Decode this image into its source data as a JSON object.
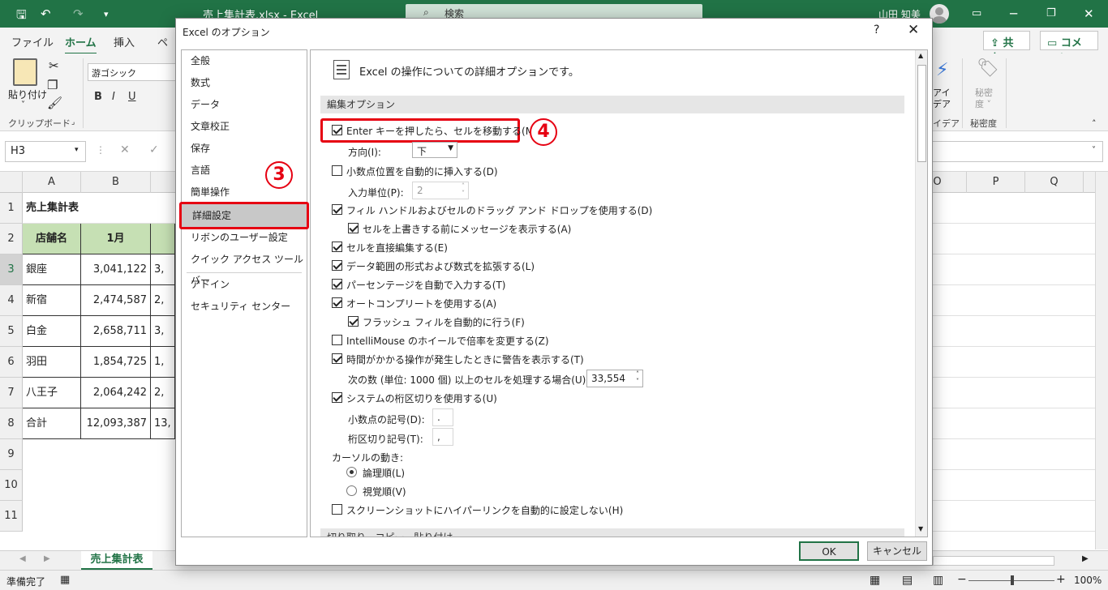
{
  "titlebar": {
    "title": "売上集計表.xlsx  -  Excel",
    "search_label": "検索",
    "user_name": "山田 知美"
  },
  "ribbon": {
    "tabs": [
      "ファイル",
      "ホーム",
      "挿入",
      "ペ"
    ],
    "share_label": "共有",
    "comment_label": "コメント",
    "paste_label": "貼り付け",
    "font_name": "游ゴシック",
    "clipboard_label": "クリップボード",
    "ideas_line1": "アイ",
    "ideas_line2": "デア",
    "ideas_group_label": "イデア",
    "sensitivity_line1": "秘密",
    "sensitivity_line2": "度 ˅",
    "sensitivity_group_label": "秘密度"
  },
  "formulabar": {
    "cell_ref": "H3"
  },
  "grid": {
    "columns_left": [
      "A",
      "B"
    ],
    "columns_right": [
      "O",
      "P",
      "Q"
    ],
    "rows": [
      "1",
      "2",
      "3",
      "4",
      "5",
      "6",
      "7",
      "8",
      "9",
      "10",
      "11"
    ],
    "title": "売上集計表",
    "header_store": "店舗名",
    "header_month": "1月",
    "data": [
      {
        "store": "銀座",
        "jan": "3,041,122",
        "next": "3,"
      },
      {
        "store": "新宿",
        "jan": "2,474,587",
        "next": "2,"
      },
      {
        "store": "白金",
        "jan": "2,658,711",
        "next": "3,"
      },
      {
        "store": "羽田",
        "jan": "1,854,725",
        "next": "1,"
      },
      {
        "store": "八王子",
        "jan": "2,064,242",
        "next": "2,"
      },
      {
        "store": "合計",
        "jan": "12,093,387",
        "next": "13,"
      }
    ]
  },
  "sheet": {
    "tab_name": "売上集計表"
  },
  "status": {
    "ready": "準備完了",
    "zoom": "100%"
  },
  "dialog": {
    "title": "Excel のオプション",
    "help": "?",
    "close": "✕",
    "nav": [
      "全般",
      "数式",
      "データ",
      "文章校正",
      "保存",
      "言語",
      "簡単操作",
      "詳細設定",
      "リボンのユーザー設定",
      "クイック アクセス ツール バー",
      "アドイン",
      "セキュリティ センター"
    ],
    "badge3": "3",
    "badge4": "4",
    "heading": "Excel の操作についての詳細オプションです。",
    "section_edit": "編集オプション",
    "section_cut": "切り取り、コピー、貼り付け",
    "options": {
      "enter_move": "Enter キーを押したら、セルを移動する(M)",
      "direction_label": "方向(I):",
      "direction_value": "下",
      "auto_decimal": "小数点位置を自動的に挿入する(D)",
      "places_label": "入力単位(P):",
      "places_value": "2",
      "fill_handle": "フィル ハンドルおよびセルのドラッグ アンド ドロップを使用する(D)",
      "alert_overwrite": "セルを上書きする前にメッセージを表示する(A)",
      "direct_edit": "セルを直接編集する(E)",
      "extend_range": "データ範囲の形式および数式を拡張する(L)",
      "percent_entry": "パーセンテージを自動で入力する(T)",
      "autocomplete": "オートコンプリートを使用する(A)",
      "flash_fill": "フラッシュ フィルを自動的に行う(F)",
      "intellimouse": "IntelliMouse のホイールで倍率を変更する(Z)",
      "long_op_alert": "時間がかかる操作が発生したときに警告を表示する(T)",
      "cells_label": "次の数 (単位: 1000 個) 以上のセルを処理する場合(U):",
      "cells_value": "33,554",
      "system_sep": "システムの桁区切りを使用する(U)",
      "decimal_sep_label": "小数点の記号(D):",
      "decimal_sep_value": ".",
      "thousands_sep_label": "桁区切り記号(T):",
      "thousands_sep_value": ",",
      "cursor_label": "カーソルの動き:",
      "logical": "論理順(L)",
      "visual": "視覚順(V)",
      "screenshot_link": "スクリーンショットにハイパーリンクを自動的に設定しない(H)"
    },
    "ok": "OK",
    "cancel": "キャンセル"
  },
  "colors": {
    "excel_green": "#217346",
    "highlight_red": "#e60012",
    "header_fill": "#c6e0b4"
  }
}
